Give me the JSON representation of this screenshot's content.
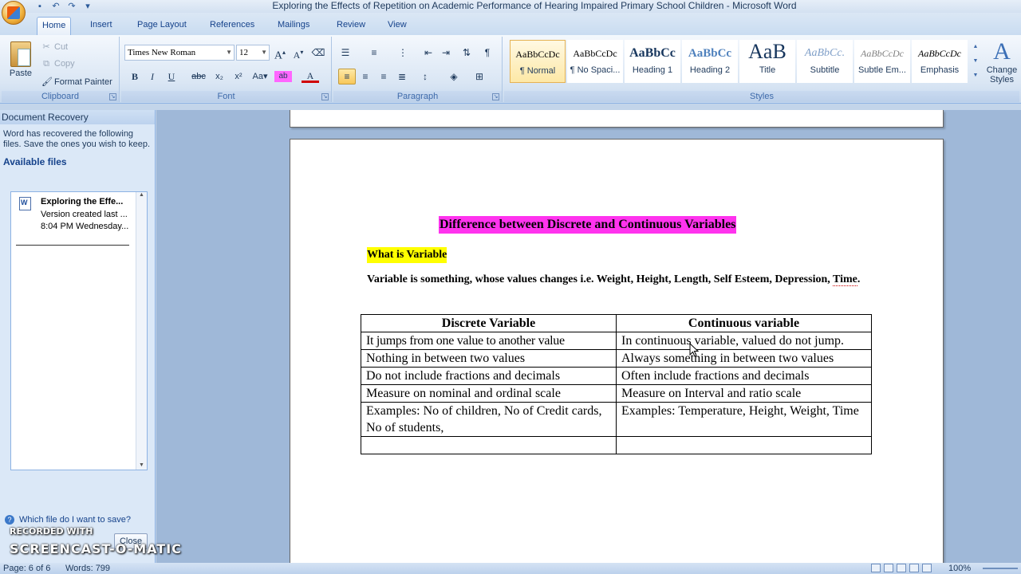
{
  "window": {
    "title": "Exploring the Effects of Repetition on Academic Performance of Hearing Impaired Primary School Children - Microsoft Word"
  },
  "tabs": [
    "Home",
    "Insert",
    "Page Layout",
    "References",
    "Mailings",
    "Review",
    "View"
  ],
  "ribbon": {
    "clipboard": {
      "paste": "Paste",
      "cut": "Cut",
      "copy": "Copy",
      "format_painter": "Format Painter",
      "label": "Clipboard"
    },
    "font": {
      "family": "Times New Roman",
      "size": "12",
      "label": "Font"
    },
    "paragraph": {
      "label": "Paragraph"
    },
    "styles": {
      "label": "Styles",
      "items": [
        {
          "sample": "AaBbCcDc",
          "name": "¶ Normal"
        },
        {
          "sample": "AaBbCcDc",
          "name": "¶ No Spaci..."
        },
        {
          "sample": "AaBbCc",
          "name": "Heading 1"
        },
        {
          "sample": "AaBbCc",
          "name": "Heading 2"
        },
        {
          "sample": "AaB",
          "name": "Title"
        },
        {
          "sample": "AaBbCc.",
          "name": "Subtitle"
        },
        {
          "sample": "AaBbCcDc",
          "name": "Subtle Em..."
        },
        {
          "sample": "AaBbCcDc",
          "name": "Emphasis"
        }
      ],
      "change_styles": "Change Styles"
    }
  },
  "recovery": {
    "title": "Document Recovery",
    "message": "Word has recovered the following files.  Save the ones you wish to keep.",
    "available": "Available files",
    "file_name": "Exploring the Effe...",
    "file_line2": "Version created last ...",
    "file_line3": "8:04 PM Wednesday...",
    "help": "Which file do I want to save?",
    "close": "Close"
  },
  "document": {
    "heading": "Difference between Discrete and Continuous Variables",
    "subheading": "What is Variable",
    "paragraph_main": "Variable is something, whose values changes i.e. Weight, Height, Length, Self Esteem, Depression, ",
    "paragraph_end": "Time",
    "paragraph_period": ".",
    "table": {
      "headers": [
        "Discrete Variable",
        "Continuous variable"
      ],
      "rows": [
        [
          "It jumps from one value to another value",
          "In continuous variable, valued do not jump."
        ],
        [
          "Nothing in between two values",
          "Always something in between two values"
        ],
        [
          "Do not include fractions and decimals",
          "Often include fractions and decimals"
        ],
        [
          "Measure on nominal and ordinal scale",
          "Measure on Interval and ratio scale"
        ],
        [
          "Examples: No of children, No of Credit cards, No of students,",
          "Examples: Temperature, Height, Weight, Time"
        ],
        [
          "",
          ""
        ]
      ]
    }
  },
  "status": {
    "page": "Page: 6 of 6",
    "words": "Words: 799",
    "zoom": "100%"
  },
  "watermark": {
    "top": "RECORDED WITH",
    "main": "SCREENCAST-O-MATIC"
  }
}
